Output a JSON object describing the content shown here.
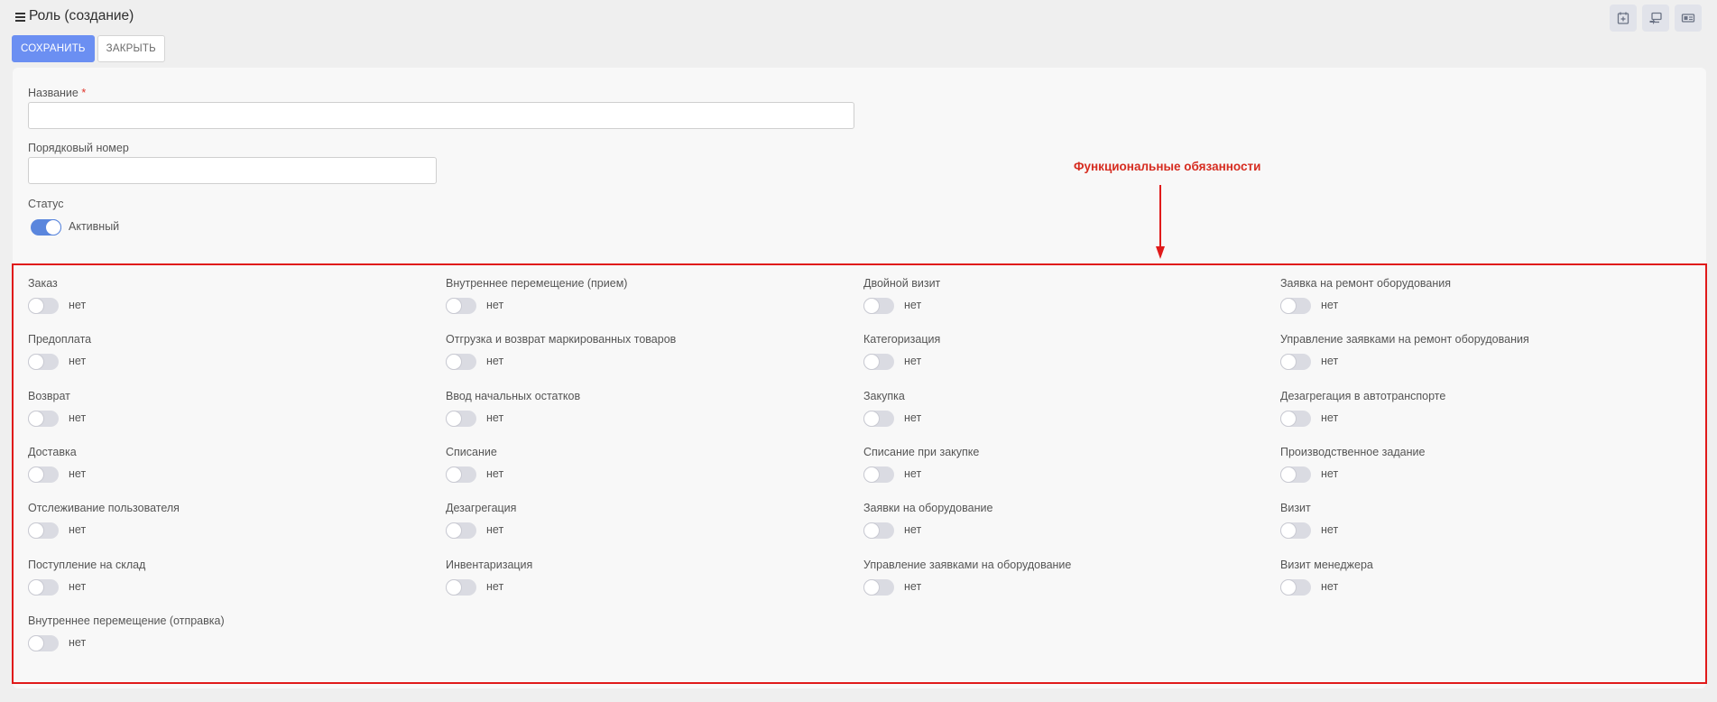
{
  "header": {
    "title": "Роль (создание)",
    "icons": [
      "calendar-add-icon",
      "monitor-transfer-icon",
      "id-card-icon"
    ]
  },
  "toolbar": {
    "save_label": "СОХРАНИТЬ",
    "close_label": "ЗАКРЫТЬ"
  },
  "form": {
    "name_label": "Название",
    "required_mark": "*",
    "name_value": "",
    "order_label": "Порядковый номер",
    "order_value": "",
    "status_label": "Статус",
    "status_value": "Активный",
    "status_on": true
  },
  "annotation": {
    "text": "Функциональные обязанности",
    "color": "#e01a1a"
  },
  "duties": {
    "off_text": "нет",
    "columns": [
      [
        "Заказ",
        "Предоплата",
        "Возврат",
        "Доставка",
        "Отслеживание пользователя",
        "Поступление на склад",
        "Внутреннее перемещение (отправка)"
      ],
      [
        "Внутреннее перемещение (прием)",
        "Отгрузка и возврат маркированных товаров",
        "Ввод начальных остатков",
        "Списание",
        "Дезагрегация",
        "Инвентаризация"
      ],
      [
        "Двойной визит",
        "Категоризация",
        "Закупка",
        "Списание при закупке",
        "Заявки на оборудование",
        "Управление заявками на оборудование"
      ],
      [
        "Заявка на ремонт оборудования",
        "Управление заявками на ремонт оборудования",
        "Дезагрегация в автотранспорте",
        "Производственное задание",
        "Визит",
        "Визит менеджера"
      ]
    ]
  },
  "colors": {
    "primary": "#6b8ff2",
    "toggle_on": "#5a86dd",
    "annotation": "#e01a1a"
  }
}
